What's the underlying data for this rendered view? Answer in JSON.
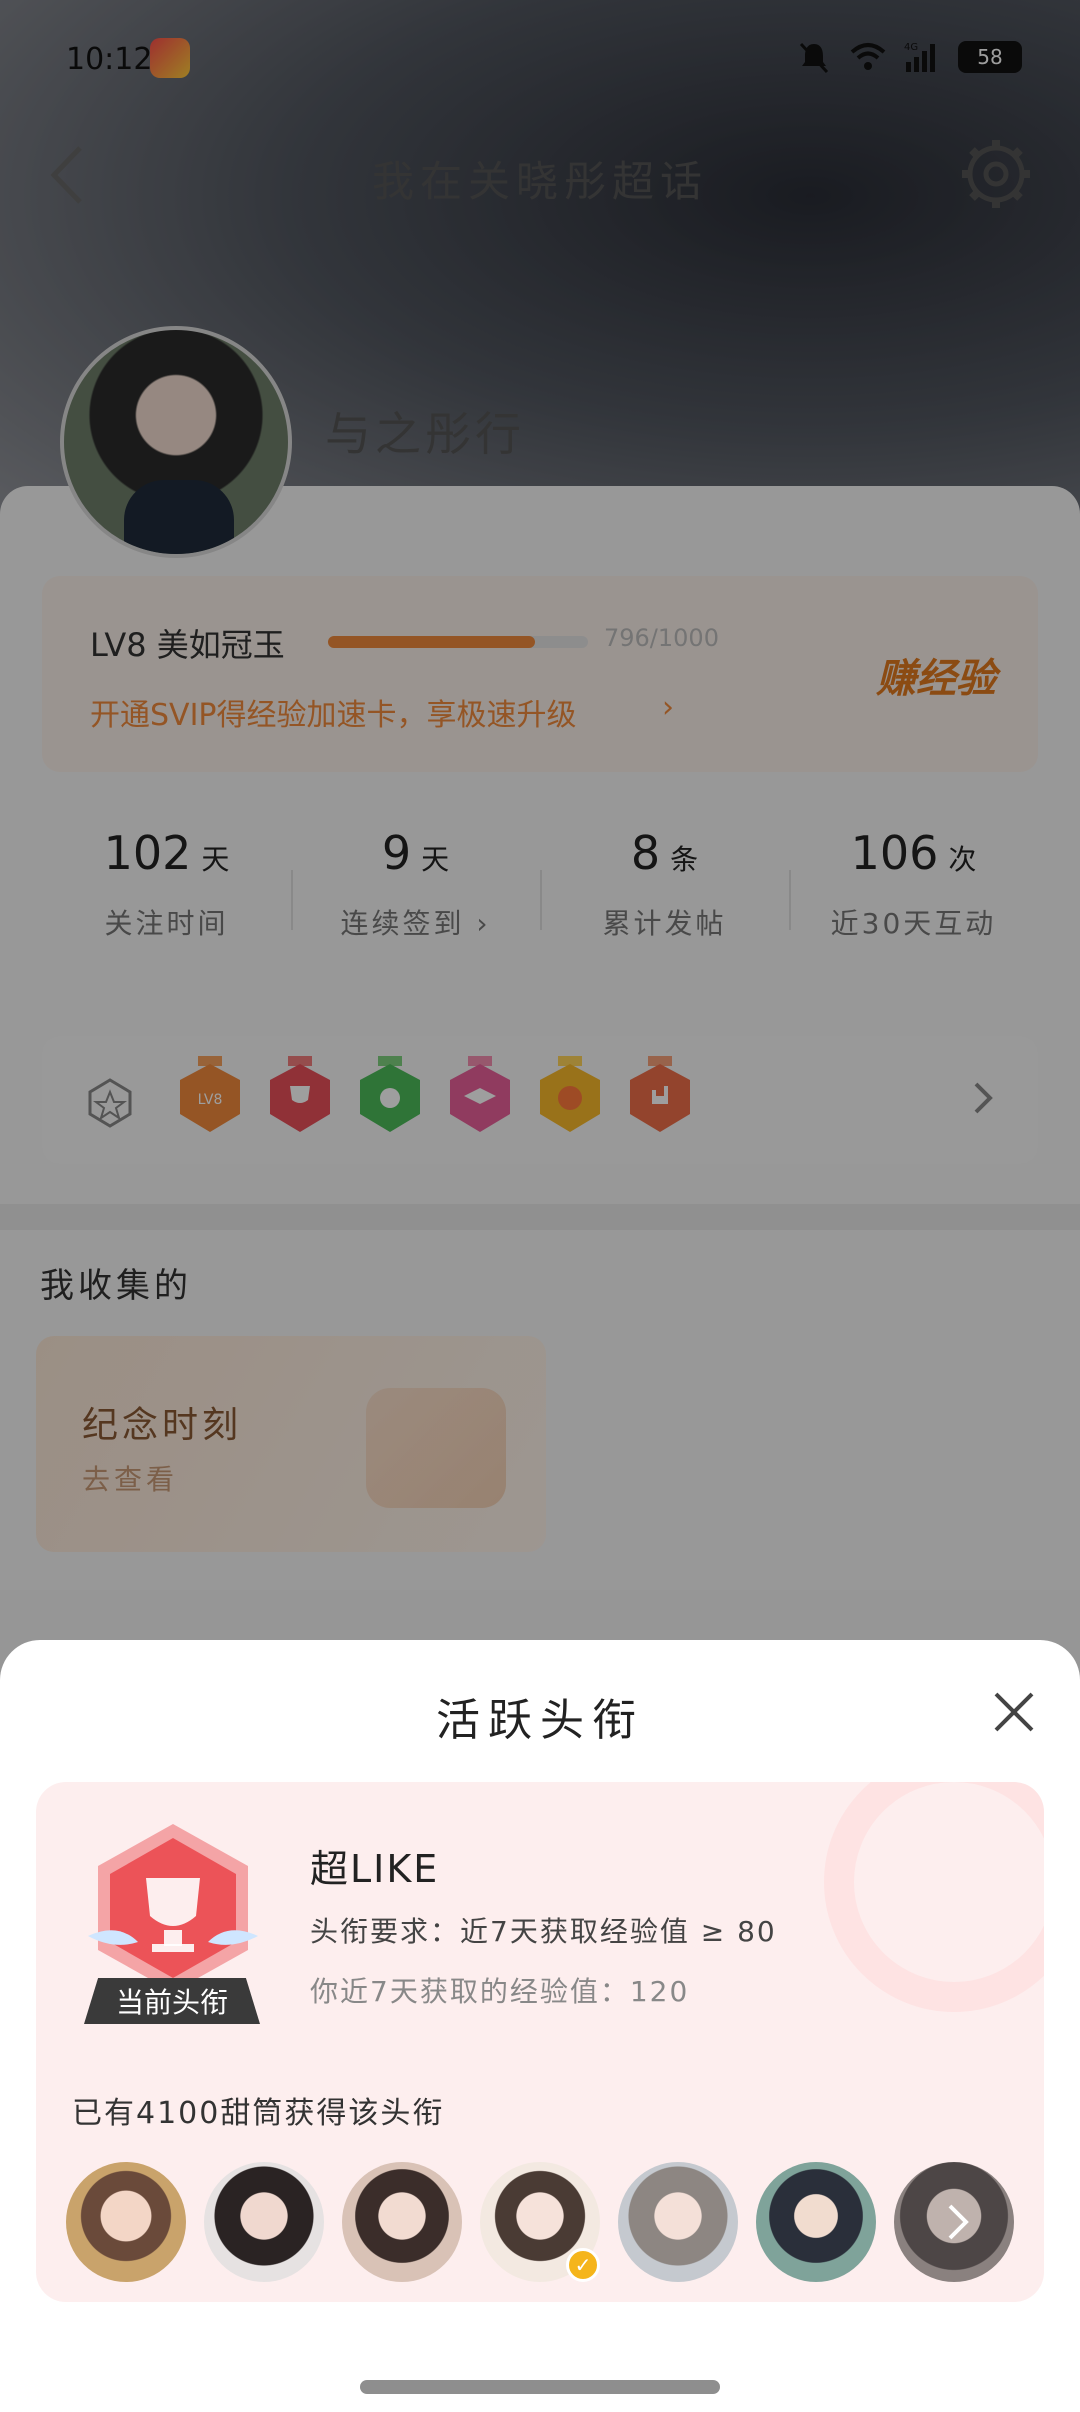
{
  "status_bar": {
    "time": "10:12",
    "network": "4G",
    "battery": "58"
  },
  "nav": {
    "title": "我在关晓彤超话"
  },
  "profile": {
    "username": "与之彤行"
  },
  "level": {
    "label": "LV8 美如冠玉",
    "progress_text": "796/1000",
    "progress_fraction": 0.796,
    "promo": "开通SVIP得经验加速卡，享极速升级",
    "earn_label": "赚经验"
  },
  "stats": [
    {
      "value": "102",
      "unit": "天",
      "label": "关注时间"
    },
    {
      "value": "9",
      "unit": "天",
      "label": "连续签到"
    },
    {
      "value": "8",
      "unit": "条",
      "label": "累计发帖"
    },
    {
      "value": "106",
      "unit": "次",
      "label": "近30天互动"
    }
  ],
  "badges": [
    "lv-badge-icon",
    "trophy-badge-icon",
    "hand-badge-icon",
    "graduate-badge-icon",
    "laugh-badge-icon",
    "like-badge-icon"
  ],
  "collect": {
    "section_title": "我收集的",
    "card_title": "纪念时刻",
    "card_sub": "去查看"
  },
  "sheet": {
    "title": "活跃头衔",
    "current_tag": "当前头衔",
    "title_name": "超LIKE",
    "requirement": "头衔要求：近7天获取经验值 ≥ 80",
    "my_exp": "你近7天获取的经验值：120",
    "holders_text": "已有4100甜筒获得该头衔"
  },
  "colors": {
    "accent": "#ef8a3c",
    "sheet_card_bg": "#fdeeee",
    "badge_red": "#f0575a"
  }
}
